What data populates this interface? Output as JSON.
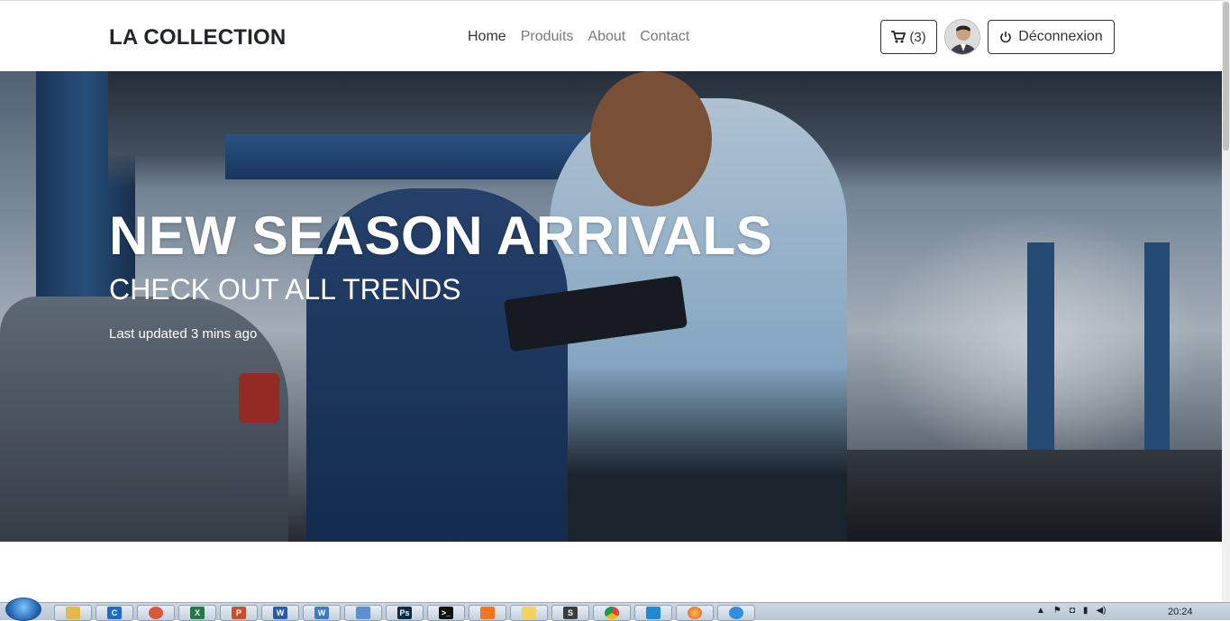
{
  "navbar": {
    "brand": "LA COLLECTION",
    "links": [
      "Home",
      "Produits",
      "About",
      "Contact"
    ],
    "cart_label": "(3)",
    "logout_label": "Déconnexion"
  },
  "hero": {
    "title": "NEW SEASON ARRIVALS",
    "subtitle": "CHECK OUT ALL TRENDS",
    "updated": "Last updated 3 mins ago"
  },
  "taskbar": {
    "apps": [
      "file-explorer",
      "ccleaner",
      "chrome-app",
      "excel",
      "powerpoint",
      "word",
      "wordpad",
      "notepad",
      "photoshop",
      "terminal",
      "xampp",
      "notes",
      "sublime-text",
      "google-chrome",
      "vscode",
      "firefox",
      "network"
    ],
    "clock": "20:24"
  }
}
